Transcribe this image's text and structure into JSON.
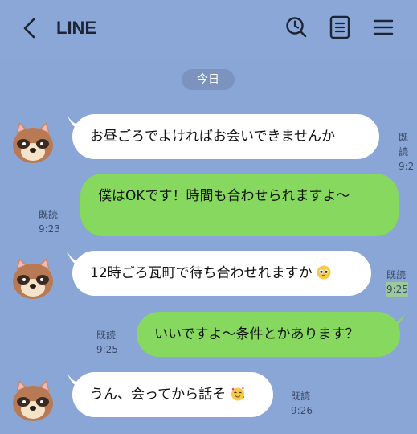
{
  "header": {
    "title": "LINE",
    "back_icon": "chevron-left-icon",
    "icons": [
      "search-clock-icon",
      "notes-icon",
      "menu-icon"
    ]
  },
  "date_label": "今日",
  "messages": [
    {
      "side": "incoming",
      "text": "お昼ごろでよければお会いできませんか",
      "read": "既読",
      "time": "9:2"
    },
    {
      "side": "outgoing",
      "text": "僕はOKです！時間も合わせられますよ〜",
      "read": "既読",
      "time": "9:23"
    },
    {
      "side": "incoming",
      "text": "12時ごろ瓦町で待ち合わせれますか",
      "emoji": "pleading-face-icon",
      "read": "既読",
      "time": "9:25"
    },
    {
      "side": "outgoing",
      "text": "いいですよ〜条件とかあります？",
      "read": "既読",
      "time": "9:25"
    },
    {
      "side": "incoming",
      "text": "うん、会ってから話そ",
      "emoji": "smiling-hearts-face-icon",
      "read": "既読",
      "time": "9:26"
    }
  ],
  "colors": {
    "background": "#8aa6d6",
    "incoming_bubble": "#ffffff",
    "outgoing_bubble": "#86d85e",
    "date_pill": "#7b93bd"
  }
}
